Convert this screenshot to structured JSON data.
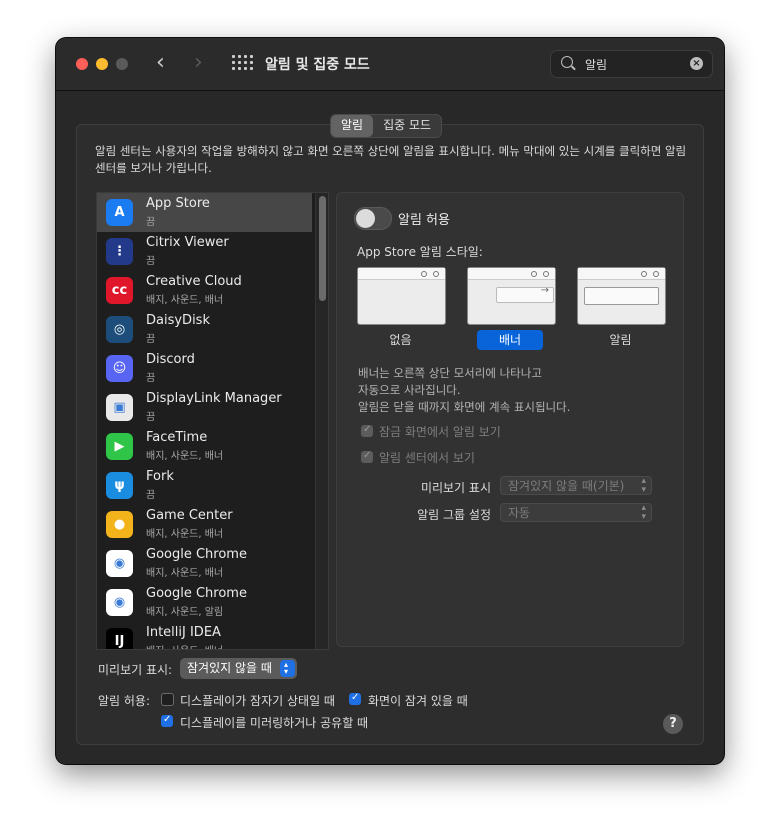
{
  "window": {
    "title": "알림 및 집중 모드"
  },
  "search": {
    "value": "알림"
  },
  "tabs": [
    {
      "label": "알림"
    },
    {
      "label": "집중 모드"
    }
  ],
  "description": "알림 센터는 사용자의 작업을 방해하지 않고 화면 오른쪽 상단에 알림을 표시합니다. 메뉴 막대에 있는 시계를 클릭하면 알림 센터를 보거나 가립니다.",
  "apps": [
    {
      "name": "App Store",
      "status": "끔",
      "icon": "app-store-icon",
      "color": "#1a7cf0"
    },
    {
      "name": "Citrix Viewer",
      "status": "끔",
      "icon": "citrix-icon",
      "color": "#233a8a"
    },
    {
      "name": "Creative Cloud",
      "status": "배지, 사운드, 배너",
      "icon": "creative-cloud-icon",
      "color": "#e0162b"
    },
    {
      "name": "DaisyDisk",
      "status": "끔",
      "icon": "daisydisk-icon",
      "color": "#1d4d7a"
    },
    {
      "name": "Discord",
      "status": "끔",
      "icon": "discord-icon",
      "color": "#5865f2"
    },
    {
      "name": "DisplayLink Manager",
      "status": "끔",
      "icon": "displaylink-icon",
      "color": "#e9e9e9"
    },
    {
      "name": "FaceTime",
      "status": "배지, 사운드, 배너",
      "icon": "facetime-icon",
      "color": "#2ec548"
    },
    {
      "name": "Fork",
      "status": "끔",
      "icon": "fork-icon",
      "color": "#1b8de0"
    },
    {
      "name": "Game Center",
      "status": "배지, 사운드, 배너",
      "icon": "game-center-icon",
      "color": "#f2b31b"
    },
    {
      "name": "Google Chrome",
      "status": "배지, 사운드, 배너",
      "icon": "chrome-icon",
      "color": "#ffffff"
    },
    {
      "name": "Google Chrome",
      "status": "배지, 사운드, 알림",
      "icon": "chrome-icon",
      "color": "#ffffff"
    },
    {
      "name": "IntelliJ IDEA",
      "status": "배지, 사운드, 배너",
      "icon": "intellij-icon",
      "color": "#000000"
    }
  ],
  "detail": {
    "allow_label": "알림 허용",
    "style_label": "App Store 알림 스타일:",
    "styles": [
      {
        "label": "없음"
      },
      {
        "label": "배너"
      },
      {
        "label": "알림"
      }
    ],
    "selected_style": "배너",
    "info": [
      "배너는 오른쪽 상단 모서리에 나타나고",
      "자동으로 사라집니다.",
      "알림은 닫을 때까지 화면에 계속 표시됩니다."
    ],
    "lock_label": "잠금 화면에서 알림 보기",
    "center_label": "알림 센터에서 보기",
    "preview_label": "미리보기 표시",
    "preview_value": "잠겨있지 않을 때(기본)",
    "group_label": "알림 그룹 설정",
    "group_value": "자동"
  },
  "bottom": {
    "preview_label": "미리보기 표시:",
    "preview_value": "잠겨있지 않을 때",
    "allow_label": "알림 허용:",
    "opt1": "디스플레이가 잠자기 상태일 때",
    "opt2": "화면이 잠겨 있을 때",
    "opt3": "디스플레이를 미러링하거나 공유할 때",
    "opt1_checked": false,
    "opt2_checked": true,
    "opt3_checked": true,
    "help": "?"
  },
  "colors": {
    "accent": "#1f6fe5",
    "selected_style": "#0a64d9"
  }
}
